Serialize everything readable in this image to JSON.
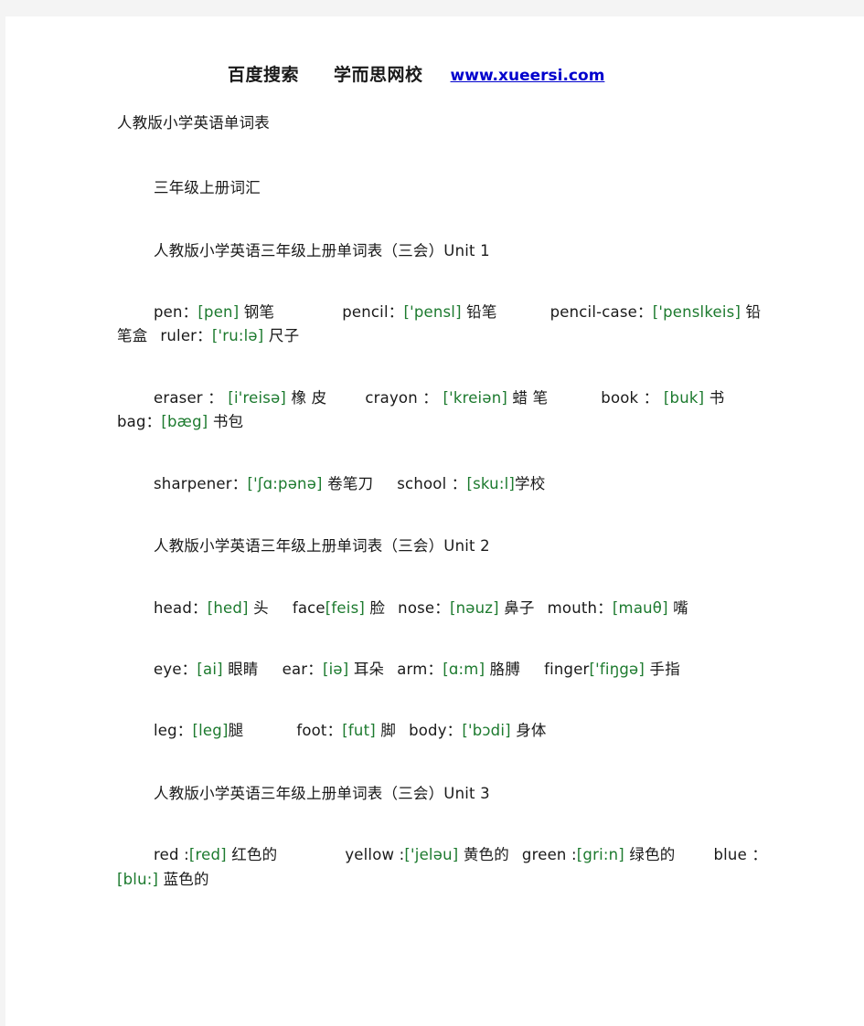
{
  "page": {
    "background_color": "#ffffff",
    "canvas_color": "#f4f4f4",
    "phonetic_color": "#1c7a2e",
    "link_color": "#0000cd",
    "text_color": "#1a1a1a"
  },
  "header": {
    "search_label": "百度搜索",
    "brand_label": "学而思网校",
    "site_url": "www.xueersi.com"
  },
  "document": {
    "title": "人教版小学英语单词表",
    "section_heading": "三年级上册词汇"
  },
  "units": [
    {
      "heading": "人教版小学英语三年级上册单词表（三会）Unit 1",
      "lines": [
        {
          "indent": "first",
          "parts": [
            {
              "t": "word",
              "v": "pen："
            },
            {
              "t": "ph",
              "v": "[pen]"
            },
            {
              "t": "cn",
              "v": " 钢笔"
            },
            {
              "t": "gap",
              "v": "sp-5"
            },
            {
              "t": "word",
              "v": "pencil："
            },
            {
              "t": "ph",
              "v": "['pensl]"
            },
            {
              "t": "cn",
              "v": " 铅笔"
            },
            {
              "t": "gap",
              "v": "sp-4"
            },
            {
              "t": "word",
              "v": "pencil-case："
            },
            {
              "t": "ph",
              "v": "['penslkeis]"
            },
            {
              "t": "cn",
              "v": " 铅"
            }
          ]
        },
        {
          "indent": "cont",
          "parts": [
            {
              "t": "cn",
              "v": "笔盒"
            },
            {
              "t": "gap",
              "v": "sp-1"
            },
            {
              "t": "word",
              "v": "ruler："
            },
            {
              "t": "ph",
              "v": "['ru:lə]"
            },
            {
              "t": "cn",
              "v": " 尺子"
            }
          ]
        },
        {
          "indent": "first",
          "parts": [
            {
              "t": "word",
              "v": "eraser ： "
            },
            {
              "t": "ph",
              "v": "[i'reisə]"
            },
            {
              "t": "cn",
              "v": " 橡 皮"
            },
            {
              "t": "gap",
              "v": "sp-3"
            },
            {
              "t": "word",
              "v": "crayon ： "
            },
            {
              "t": "ph",
              "v": "['kreiən]"
            },
            {
              "t": "cn",
              "v": " 蜡 笔"
            },
            {
              "t": "gap",
              "v": "sp-4"
            },
            {
              "t": "word",
              "v": "book ： "
            },
            {
              "t": "ph",
              "v": "[buk]"
            },
            {
              "t": "cn",
              "v": " 书"
            }
          ]
        },
        {
          "indent": "cont",
          "parts": [
            {
              "t": "word",
              "v": "bag："
            },
            {
              "t": "ph",
              "v": "[bæg]"
            },
            {
              "t": "cn",
              "v": " 书包"
            }
          ]
        },
        {
          "indent": "first",
          "parts": [
            {
              "t": "word",
              "v": "sharpener："
            },
            {
              "t": "ph",
              "v": "['ʃɑ:pənə]"
            },
            {
              "t": "cn",
              "v": " 卷笔刀"
            },
            {
              "t": "gap",
              "v": "sp-2"
            },
            {
              "t": "word",
              "v": "school  ："
            },
            {
              "t": "ph",
              "v": "[sku:l]"
            },
            {
              "t": "cn",
              "v": "学校"
            }
          ]
        }
      ]
    },
    {
      "heading": "人教版小学英语三年级上册单词表（三会）Unit 2",
      "lines": [
        {
          "indent": "first",
          "parts": [
            {
              "t": "word",
              "v": "head："
            },
            {
              "t": "ph",
              "v": "[hed]"
            },
            {
              "t": "cn",
              "v": " 头"
            },
            {
              "t": "gap",
              "v": "sp-2"
            },
            {
              "t": "word",
              "v": "face"
            },
            {
              "t": "ph",
              "v": "[feis]"
            },
            {
              "t": "cn",
              "v": " 脸"
            },
            {
              "t": "gap",
              "v": "sp-1"
            },
            {
              "t": "word",
              "v": "nose："
            },
            {
              "t": "ph",
              "v": "[nəuz]"
            },
            {
              "t": "cn",
              "v": " 鼻子"
            },
            {
              "t": "gap",
              "v": "sp-1"
            },
            {
              "t": "word",
              "v": "mouth："
            },
            {
              "t": "ph",
              "v": "[mauθ]"
            },
            {
              "t": "cn",
              "v": " 嘴"
            }
          ]
        },
        {
          "indent": "first",
          "parts": [
            {
              "t": "word",
              "v": "eye："
            },
            {
              "t": "ph",
              "v": "[ai]"
            },
            {
              "t": "cn",
              "v": " 眼睛"
            },
            {
              "t": "gap",
              "v": "sp-2"
            },
            {
              "t": "word",
              "v": "ear："
            },
            {
              "t": "ph",
              "v": "[iə]"
            },
            {
              "t": "cn",
              "v": " 耳朵"
            },
            {
              "t": "gap",
              "v": "sp-1"
            },
            {
              "t": "word",
              "v": "arm："
            },
            {
              "t": "ph",
              "v": "[ɑ:m]"
            },
            {
              "t": "cn",
              "v": " 胳膊"
            },
            {
              "t": "gap",
              "v": "sp-2"
            },
            {
              "t": "word",
              "v": "finger"
            },
            {
              "t": "ph",
              "v": "['fiŋgə]"
            },
            {
              "t": "cn",
              "v": " 手指"
            }
          ]
        },
        {
          "indent": "first",
          "parts": [
            {
              "t": "word",
              "v": "leg："
            },
            {
              "t": "ph",
              "v": "[leg]"
            },
            {
              "t": "cn",
              "v": "腿"
            },
            {
              "t": "gap",
              "v": "sp-4"
            },
            {
              "t": "word",
              "v": "foot："
            },
            {
              "t": "ph",
              "v": "[fut]"
            },
            {
              "t": "cn",
              "v": " 脚"
            },
            {
              "t": "gap",
              "v": "sp-1"
            },
            {
              "t": "word",
              "v": "body："
            },
            {
              "t": "ph",
              "v": "['bɔdi]"
            },
            {
              "t": "cn",
              "v": " 身体"
            }
          ]
        }
      ]
    },
    {
      "heading": "人教版小学英语三年级上册单词表（三会）Unit 3",
      "lines": [
        {
          "indent": "first",
          "parts": [
            {
              "t": "word",
              "v": "red :"
            },
            {
              "t": "ph",
              "v": "[red]"
            },
            {
              "t": "cn",
              "v": " 红色的"
            },
            {
              "t": "gap",
              "v": "sp-5"
            },
            {
              "t": "word",
              "v": "yellow :"
            },
            {
              "t": "ph",
              "v": "['jeləu]"
            },
            {
              "t": "cn",
              "v": " 黄色的"
            },
            {
              "t": "gap",
              "v": "sp-1"
            },
            {
              "t": "word",
              "v": "green :"
            },
            {
              "t": "ph",
              "v": "[gri:n]"
            },
            {
              "t": "cn",
              "v": " 绿色的"
            },
            {
              "t": "gap",
              "v": "sp-3"
            },
            {
              "t": "word",
              "v": "blue ："
            }
          ]
        },
        {
          "indent": "cont",
          "parts": [
            {
              "t": "ph",
              "v": "[blu:]"
            },
            {
              "t": "cn",
              "v": " 蓝色的"
            }
          ]
        }
      ]
    }
  ]
}
